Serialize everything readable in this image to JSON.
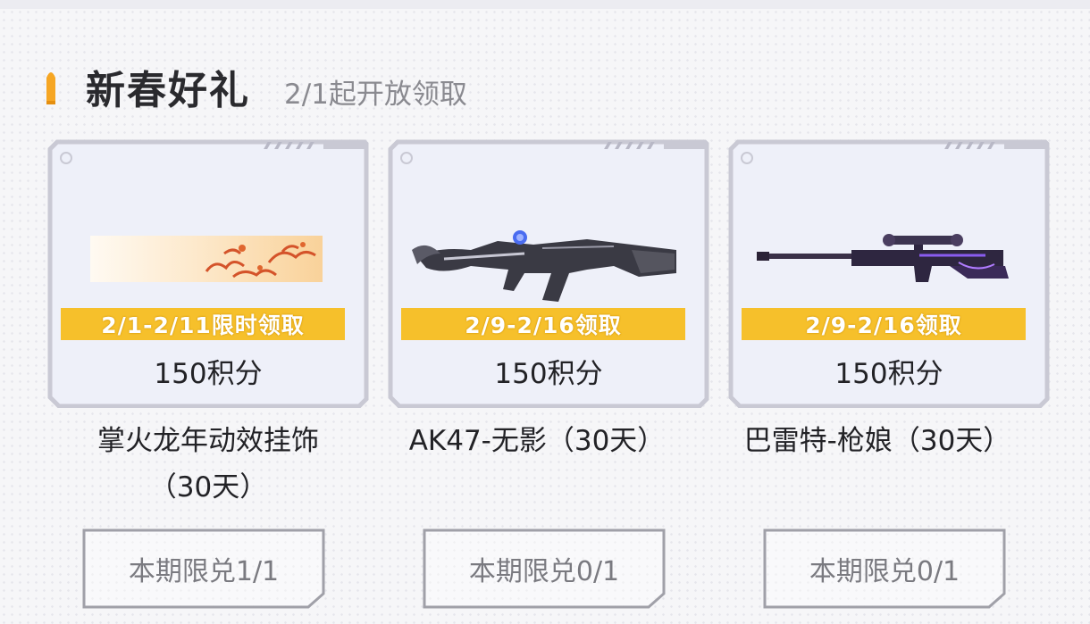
{
  "section": {
    "title": "新春好礼",
    "subtitle": "2/1起开放领取"
  },
  "colors": {
    "accent": "#f6a623",
    "ribbon": "#f6c02b",
    "card_bg": "#eef0f9",
    "frame": "#c9c9d4"
  },
  "cards": [
    {
      "image_icon": "dragon-pendant-icon",
      "date": "2/1-2/11限时领取",
      "points": "150积分",
      "name_line1": "掌火龙年动效挂饰",
      "name_line2": "（30天）",
      "button": "本期限兑1/1"
    },
    {
      "image_icon": "ak47-rifle-icon",
      "date": "2/9-2/16领取",
      "points": "150积分",
      "name_line1": "AK47-无影（30天）",
      "button": "本期限兑0/1"
    },
    {
      "image_icon": "sniper-rifle-icon",
      "date": "2/9-2/16领取",
      "points": "150积分",
      "name_line1": "巴雷特-枪娘（30天）",
      "button": "本期限兑0/1"
    }
  ]
}
